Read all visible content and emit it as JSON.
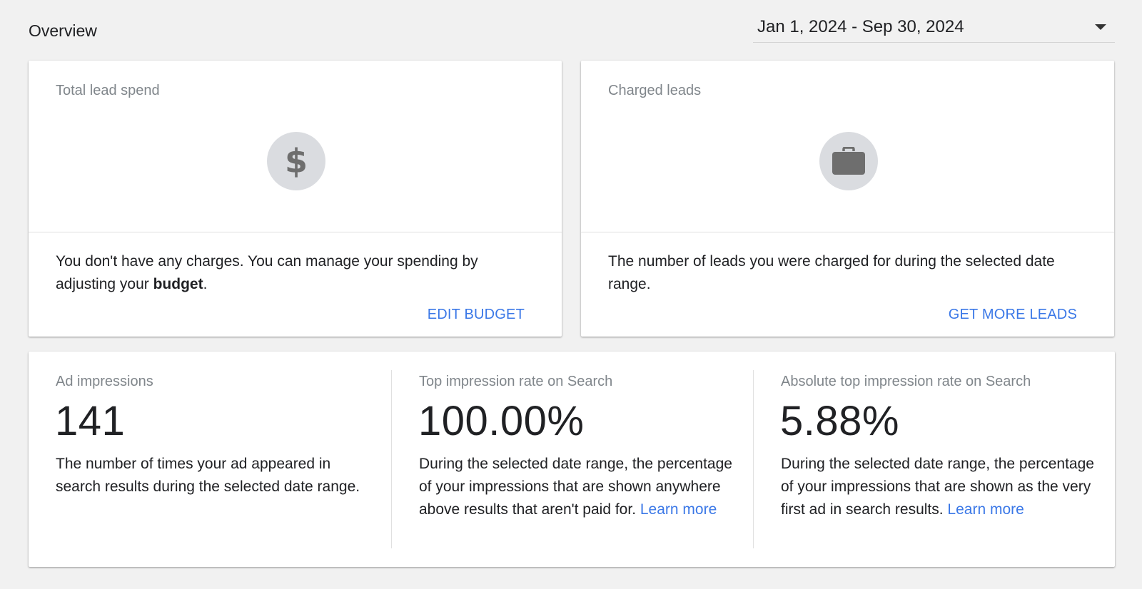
{
  "header": {
    "title": "Overview",
    "date_range": "Jan 1, 2024 - Sep 30, 2024"
  },
  "cards": {
    "lead_spend": {
      "label": "Total lead spend",
      "icon": "dollar-icon",
      "body_prefix": "You don't have any charges. You can manage your spending by adjusting your ",
      "body_bold": "budget",
      "body_suffix": ".",
      "action": "EDIT BUDGET"
    },
    "charged_leads": {
      "label": "Charged leads",
      "icon": "briefcase-icon",
      "body": "The number of leads you were charged for during the selected date range.",
      "action": "GET MORE LEADS"
    }
  },
  "metrics": [
    {
      "label": "Ad impressions",
      "value": "141",
      "description": "The number of times your ad appeared in search results during the selected date range.",
      "link": ""
    },
    {
      "label": "Top impression rate on Search",
      "value": "100.00%",
      "description": "During the selected date range, the percentage of your impressions that are shown anywhere above results that aren't paid for. ",
      "link": "Learn more"
    },
    {
      "label": "Absolute top impression rate on Search",
      "value": "5.88%",
      "description": "During the selected date range, the percentage of your impressions that are shown as the very first ad in search results. ",
      "link": "Learn more"
    }
  ],
  "colors": {
    "background": "#f1f1f1",
    "card": "#ffffff",
    "accent_link": "#3b78e7",
    "muted_text": "#80868b",
    "icon_circle": "#dadce0"
  }
}
